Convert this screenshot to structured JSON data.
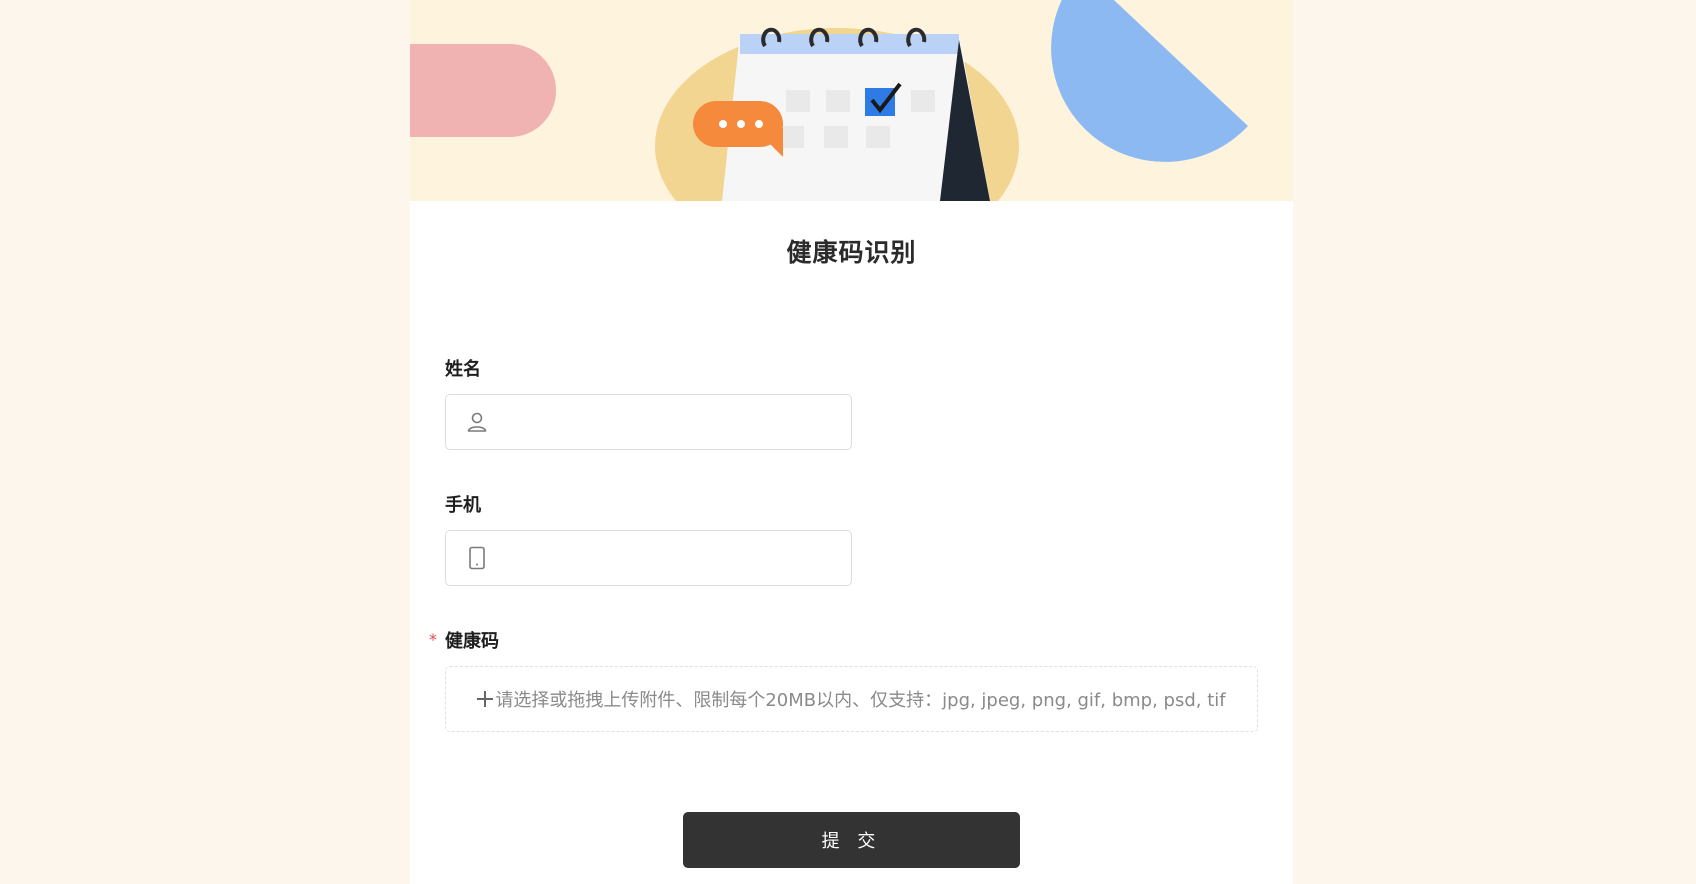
{
  "form": {
    "title": "健康码识别",
    "submit_label": "提 交"
  },
  "fields": {
    "name": {
      "label": "姓名",
      "value": "",
      "icon": "user-icon"
    },
    "phone": {
      "label": "手机",
      "value": "",
      "icon": "mobile-phone-icon"
    },
    "health_code": {
      "label": "健康码",
      "required_mark": "*",
      "upload_hint": "请选择或拖拽上传附件、限制每个20MB以内、仅支持：jpg, jpeg, png, gif, bmp, psd, tif",
      "icon": "plus-icon"
    }
  },
  "colors": {
    "page_background": "#fdf6ec",
    "banner_background": "#fef3dd",
    "submit_button": "#333333",
    "required": "#e5484d",
    "checkbox_accent": "#2f7be5"
  }
}
